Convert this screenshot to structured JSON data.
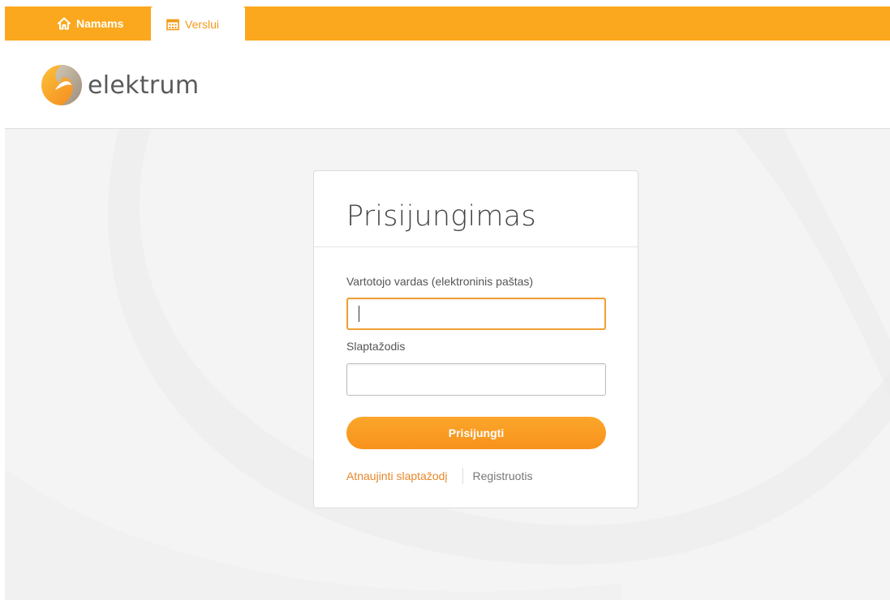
{
  "topbar": {
    "tabs": [
      {
        "label": "Namams",
        "icon": "home-icon",
        "active": false
      },
      {
        "label": "Verslui",
        "icon": "building-icon",
        "active": true
      }
    ],
    "color": "#fba81e"
  },
  "header": {
    "logo_text": "elektrum",
    "logo_icon": "elektrum-logo-icon"
  },
  "login": {
    "title": "Prisijungimas",
    "username_label": "Vartotojo vardas (elektroninis paštas)",
    "username_value": "",
    "password_label": "Slaptažodis",
    "password_value": "",
    "submit_label": "Prisijungti",
    "reset_password_link": "Atnaujinti slaptažodį",
    "register_link": "Registruotis"
  },
  "colors": {
    "accent": "#fba81e",
    "button": "#f8921c",
    "link": "#e8882a",
    "background": "#f4f4f4"
  }
}
